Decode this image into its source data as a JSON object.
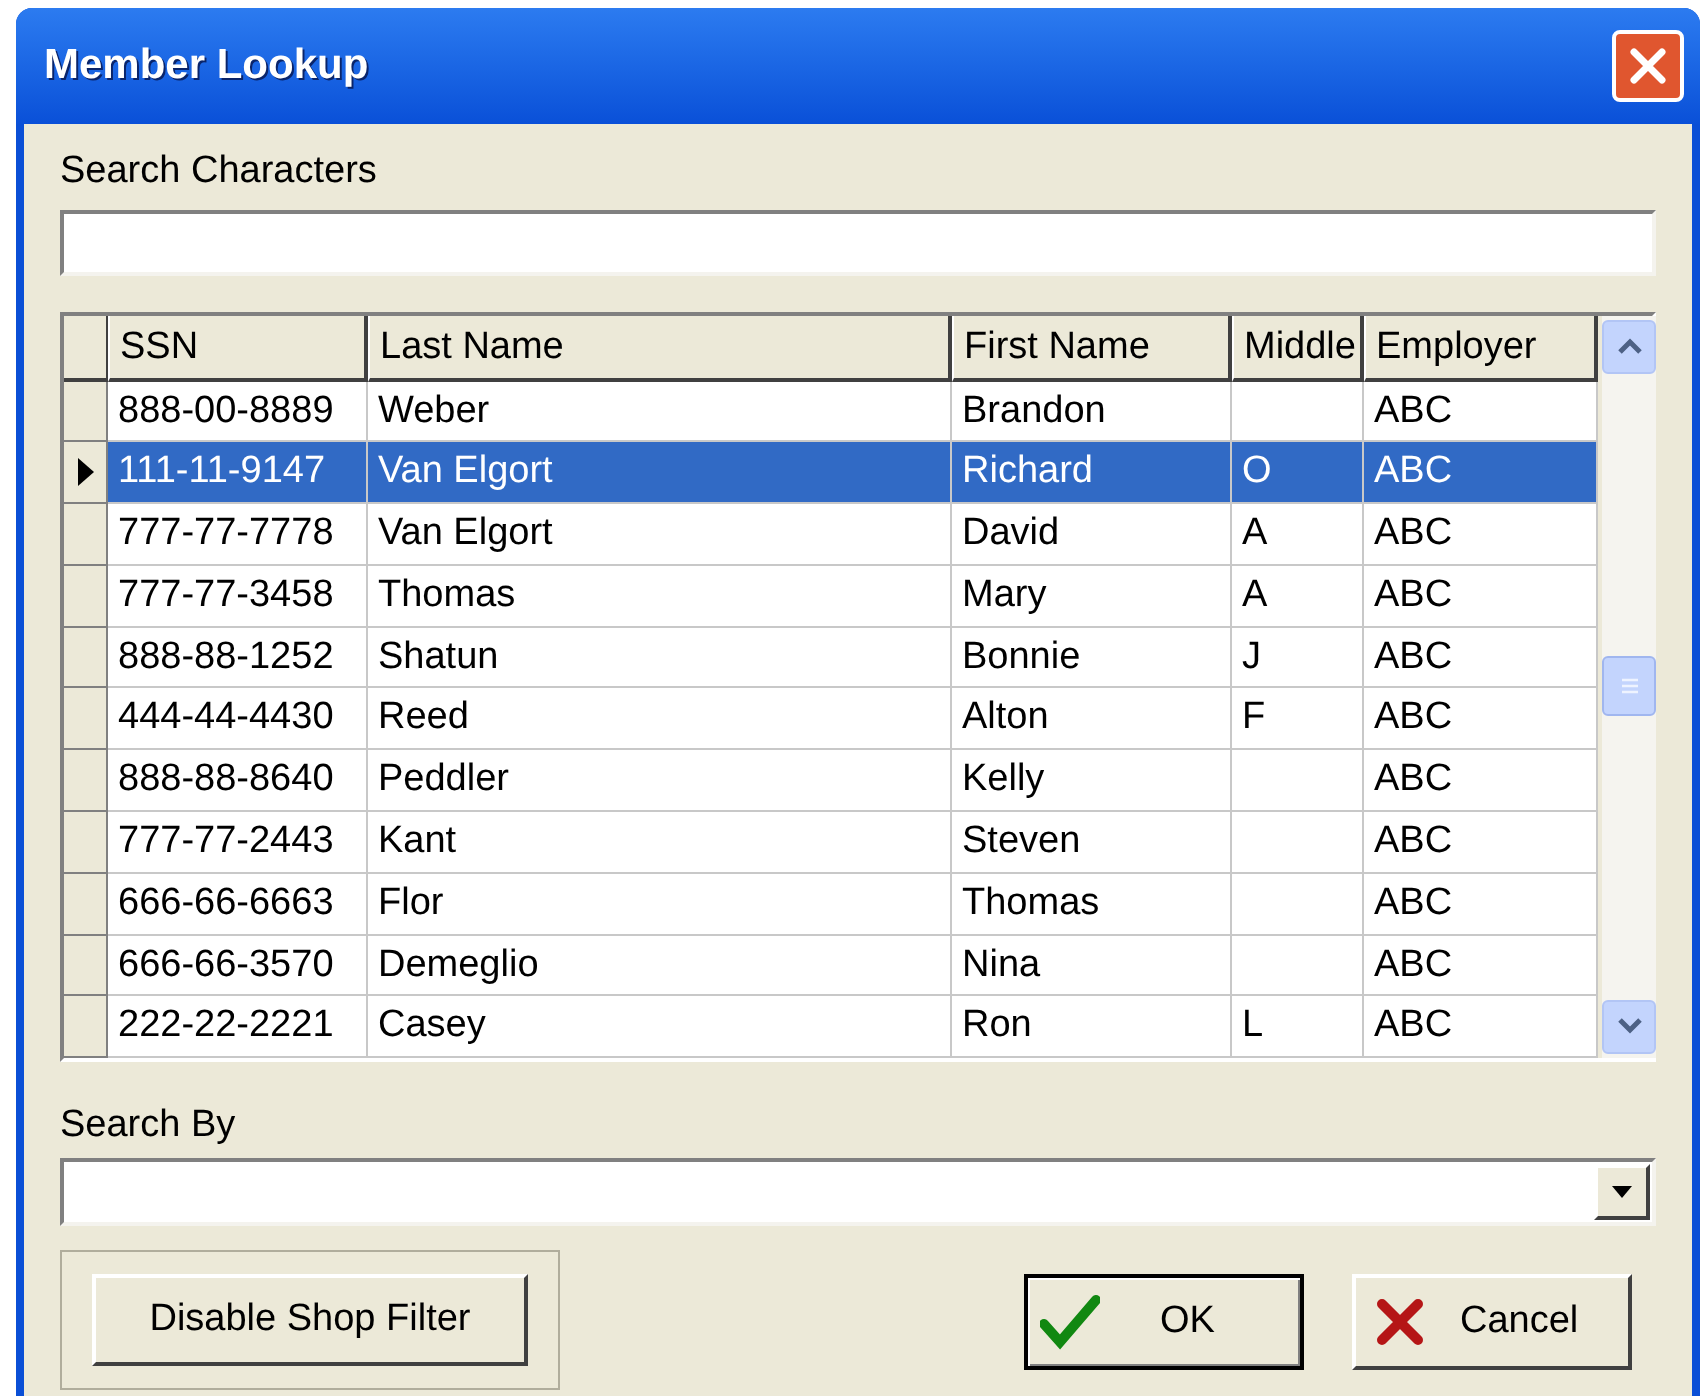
{
  "window": {
    "title": "Member Lookup"
  },
  "search_characters": {
    "label": "Search Characters"
  },
  "table": {
    "columns": [
      "SSN",
      "Last Name",
      "First Name",
      "Middle",
      "Employer"
    ],
    "rows": [
      {
        "cells": [
          "888-00-8889",
          "Weber",
          "Brandon",
          "",
          "ABC"
        ],
        "selected": false
      },
      {
        "cells": [
          "111-11-9147",
          "Van Elgort",
          "Richard",
          "O",
          "ABC"
        ],
        "selected": true
      },
      {
        "cells": [
          "777-77-7778",
          "Van Elgort",
          "David",
          "A",
          "ABC"
        ],
        "selected": false
      },
      {
        "cells": [
          "777-77-3458",
          "Thomas",
          "Mary",
          "A",
          "ABC"
        ],
        "selected": false
      },
      {
        "cells": [
          "888-88-1252",
          "Shatun",
          "Bonnie",
          "J",
          "ABC"
        ],
        "selected": false
      },
      {
        "cells": [
          "444-44-4430",
          "Reed",
          "Alton",
          "F",
          "ABC"
        ],
        "selected": false
      },
      {
        "cells": [
          "888-88-8640",
          "Peddler",
          "Kelly",
          "",
          "ABC"
        ],
        "selected": false
      },
      {
        "cells": [
          "777-77-2443",
          "Kant",
          "Steven",
          "",
          "ABC"
        ],
        "selected": false
      },
      {
        "cells": [
          "666-66-6663",
          "Flor",
          "Thomas",
          "",
          "ABC"
        ],
        "selected": false
      },
      {
        "cells": [
          "666-66-3570",
          "Demeglio",
          "Nina",
          "",
          "ABC"
        ],
        "selected": false
      },
      {
        "cells": [
          "222-22-2221",
          "Casey",
          "Ron",
          "L",
          "ABC"
        ],
        "selected": false
      }
    ]
  },
  "search_by": {
    "label": "Search By"
  },
  "buttons": {
    "filter": "Disable Shop Filter",
    "ok": "OK",
    "cancel": "Cancel"
  }
}
